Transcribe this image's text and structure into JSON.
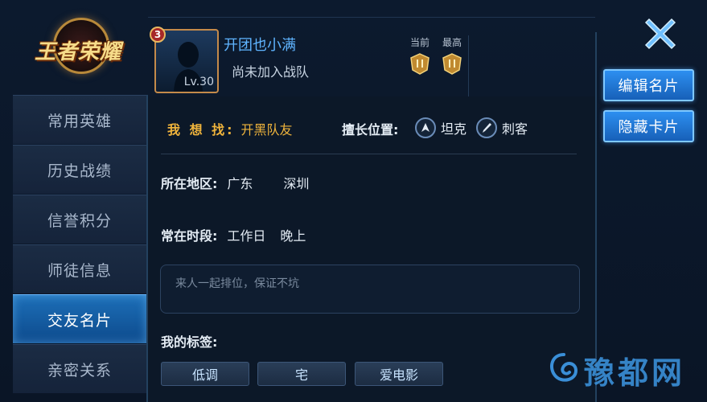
{
  "logo": {
    "text": "王者荣耀"
  },
  "sidebar": {
    "items": [
      {
        "label": "常用英雄",
        "active": false
      },
      {
        "label": "历史战绩",
        "active": false
      },
      {
        "label": "信誉积分",
        "active": false
      },
      {
        "label": "师徒信息",
        "active": false
      },
      {
        "label": "交友名片",
        "active": true
      },
      {
        "label": "亲密关系",
        "active": false
      }
    ]
  },
  "profile": {
    "badge": "3",
    "level": "Lv.30",
    "name": "开团也小满",
    "team_status": "尚未加入战队",
    "rank": {
      "current_label": "当前",
      "best_label": "最高"
    }
  },
  "card": {
    "find_label": "我 想 找:",
    "find_value": "开黑队友",
    "position_label": "擅长位置:",
    "positions": [
      {
        "name": "坦克",
        "icon": "tank-icon"
      },
      {
        "name": "刺客",
        "icon": "assassin-icon"
      }
    ],
    "region_label": "所在地区:",
    "region_province": "广东",
    "region_city": "深圳",
    "time_label": "常在时段:",
    "time_days": "工作日",
    "time_period": "晚上",
    "motto": "来人一起排位，保证不坑",
    "tags_label": "我的标签:",
    "tags": [
      "低调",
      "宅",
      "爱电影"
    ]
  },
  "actions": {
    "edit": "编辑名片",
    "hide": "隐藏卡片",
    "close_icon": "close-icon"
  },
  "watermark": {
    "text": "豫都网"
  },
  "colors": {
    "accent": "#2d8ff0",
    "name": "#5fb4ff",
    "highlight": "#f0b43c",
    "background": "#0a1628"
  }
}
